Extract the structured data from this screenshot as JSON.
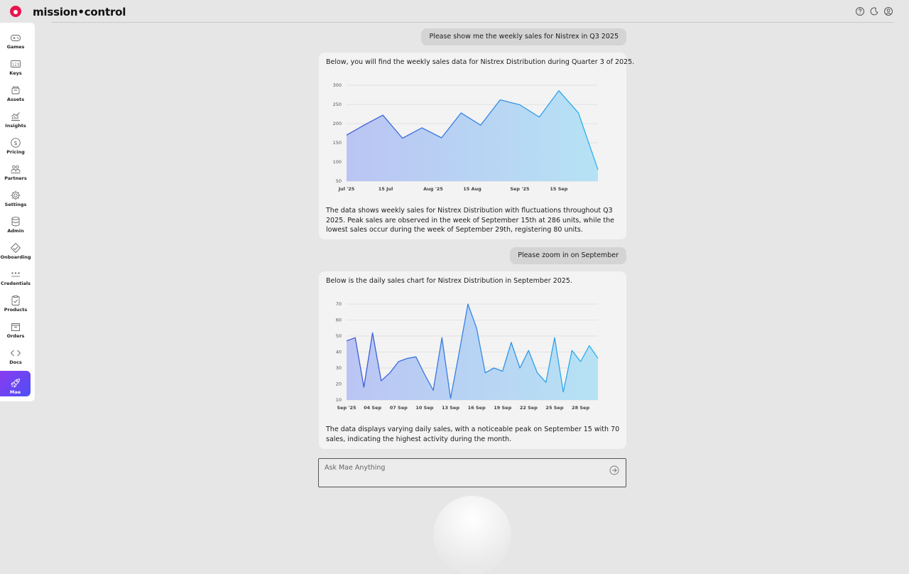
{
  "app": {
    "logo_text": "mission•control"
  },
  "top_icons": [
    "help-icon",
    "moon-icon",
    "user-icon"
  ],
  "sidebar": {
    "items": [
      {
        "label": "Games",
        "icon": "gamepad-icon"
      },
      {
        "label": "Keys",
        "icon": "keys-icon"
      },
      {
        "label": "Assets",
        "icon": "box-icon"
      },
      {
        "label": "Insights",
        "icon": "chart-icon"
      },
      {
        "label": "Pricing",
        "icon": "dollar-icon"
      },
      {
        "label": "Partners",
        "icon": "people-icon"
      },
      {
        "label": "Settings",
        "icon": "gear-icon"
      },
      {
        "label": "Admin",
        "icon": "database-icon"
      },
      {
        "label": "Onboarding",
        "icon": "handshake-icon"
      },
      {
        "label": "Credentials",
        "icon": "dots-icon"
      },
      {
        "label": "Products",
        "icon": "clipboard-icon"
      },
      {
        "label": "Orders",
        "icon": "cart-icon"
      },
      {
        "label": "Docs",
        "icon": "code-icon"
      },
      {
        "label": "Mae",
        "icon": "rocket-icon",
        "active": true
      }
    ]
  },
  "chat": {
    "msg1": "Please show me the weekly sales for Nistrex in Q3 2025",
    "card1_intro": "Below, you will find the weekly sales data for Nistrex Distribution during Quarter 3 of 2025.",
    "card1_desc": "The data shows weekly sales for Nistrex Distribution with fluctuations throughout Q3 2025. Peak sales are observed in the week of September 15th at 286 units, while the lowest sales occur during the week of September 29th, registering 80 units.",
    "msg2": "Please zoom in on September",
    "card2_intro": "Below is the daily sales chart for Nistrex Distribution in September 2025.",
    "card2_desc": "The data displays varying daily sales, with a noticeable peak on September 15 with 70 sales, indicating the highest activity during the month."
  },
  "input": {
    "placeholder": "Ask Mae Anything"
  },
  "chart_data": [
    {
      "type": "area",
      "x": [
        "2025-07-01",
        "2025-07-07",
        "2025-07-14",
        "2025-07-21",
        "2025-07-28",
        "2025-08-04",
        "2025-08-11",
        "2025-08-18",
        "2025-08-25",
        "2025-09-01",
        "2025-09-08",
        "2025-09-15",
        "2025-09-22",
        "2025-09-29"
      ],
      "values": [
        170,
        195,
        222,
        162,
        189,
        163,
        228,
        196,
        262,
        249,
        217,
        286,
        228,
        80
      ],
      "xticks": [
        {
          "x": "2025-07-01",
          "label": "Jul '25",
          "bold": true
        },
        {
          "x": "2025-07-15",
          "label": "15 Jul"
        },
        {
          "x": "2025-08-01",
          "label": "Aug '25",
          "bold": true
        },
        {
          "x": "2025-08-15",
          "label": "15 Aug"
        },
        {
          "x": "2025-09-01",
          "label": "Sep '25",
          "bold": true
        },
        {
          "x": "2025-09-15",
          "label": "15 Sep"
        }
      ],
      "yticks": [
        300,
        250,
        200,
        150,
        100,
        50
      ],
      "ylim": [
        50,
        300
      ],
      "grid": true
    },
    {
      "type": "area",
      "x": [
        1,
        2,
        3,
        4,
        5,
        6,
        7,
        8,
        9,
        10,
        11,
        12,
        13,
        14,
        15,
        16,
        17,
        18,
        19,
        20,
        21,
        22,
        23,
        24,
        25,
        26,
        27,
        28,
        29,
        30
      ],
      "values": [
        47,
        49,
        18,
        52,
        22,
        27,
        34,
        36,
        37,
        26,
        16,
        49,
        11,
        40,
        70,
        55,
        27,
        30,
        28,
        46,
        30,
        41,
        27,
        21,
        49,
        15,
        41,
        34,
        44,
        36
      ],
      "xticks": [
        {
          "x": 1,
          "label": "Sep '25",
          "bold": true
        },
        {
          "x": 4,
          "label": "04 Sep"
        },
        {
          "x": 7,
          "label": "07 Sep"
        },
        {
          "x": 10,
          "label": "10 Sep"
        },
        {
          "x": 13,
          "label": "13 Sep"
        },
        {
          "x": 16,
          "label": "16 Sep"
        },
        {
          "x": 19,
          "label": "19 Sep"
        },
        {
          "x": 22,
          "label": "22 Sep"
        },
        {
          "x": 25,
          "label": "25 Sep"
        },
        {
          "x": 28,
          "label": "28 Sep"
        }
      ],
      "yticks": [
        70,
        60,
        50,
        40,
        30,
        20,
        10
      ],
      "ylim": [
        10,
        70
      ],
      "grid": true
    }
  ]
}
